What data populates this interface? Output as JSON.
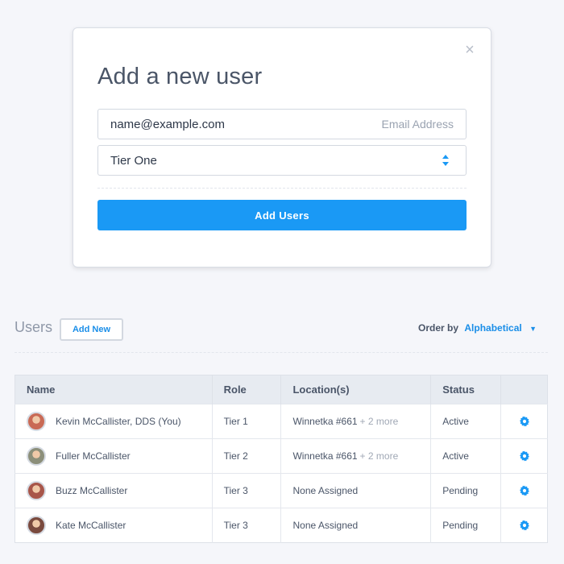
{
  "modal": {
    "title": "Add a new user",
    "close_symbol": "×",
    "email_value": "name@example.com",
    "email_hint": "Email Address",
    "tier_value": "Tier One",
    "submit_label": "Add Users"
  },
  "users_section": {
    "title": "Users",
    "add_new_label": "Add New",
    "order_label": "Order by",
    "order_value": "Alphabetical",
    "order_caret": "▼"
  },
  "table": {
    "headers": [
      "Name",
      "Role",
      "Location(s)",
      "Status"
    ],
    "rows": [
      {
        "name": "Kevin McCallister, DDS (You)",
        "role": "Tier 1",
        "location": "Winnetka #661",
        "location_more": "+ 2 more",
        "status": "Active",
        "avatar_color": "#c96a55"
      },
      {
        "name": "Fuller McCallister",
        "role": "Tier 2",
        "location": "Winnetka #661",
        "location_more": "+ 2 more",
        "status": "Active",
        "avatar_color": "#8c8f7a"
      },
      {
        "name": "Buzz McCallister",
        "role": "Tier 3",
        "location": "None Assigned",
        "location_more": "",
        "status": "Pending",
        "avatar_color": "#a8564a"
      },
      {
        "name": "Kate McCallister",
        "role": "Tier 3",
        "location": "None Assigned",
        "location_more": "",
        "status": "Pending",
        "avatar_color": "#7a4a3e"
      }
    ]
  },
  "colors": {
    "accent": "#1a99f5",
    "link": "#1a8ee8",
    "header_bg": "#e7ebf1",
    "page_bg": "#f5f6fa"
  },
  "icons": {
    "close": "close-icon",
    "select": "select-arrows-icon",
    "row_action": "gear-icon"
  }
}
